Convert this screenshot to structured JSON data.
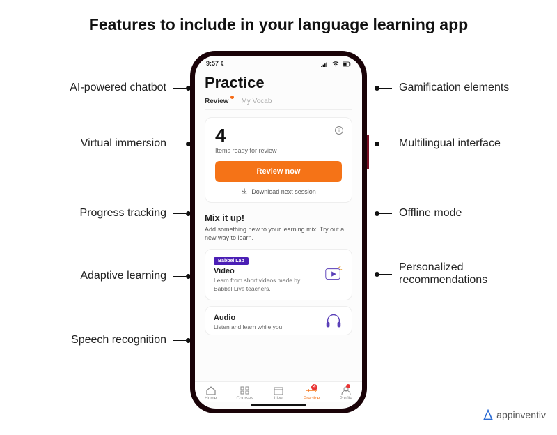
{
  "title": "Features to include in your language learning app",
  "left_features": [
    "AI-powered chatbot",
    "Virtual immersion",
    "Progress tracking",
    "Adaptive learning",
    "Speech recognition"
  ],
  "right_features": [
    "Gamification elements",
    "Multilingual interface",
    "Offline mode",
    "Personalized recommendations"
  ],
  "phone": {
    "status_time": "9:57",
    "page_title": "Practice",
    "tabs": {
      "review": "Review",
      "my_vocab": "My Vocab"
    },
    "review_card": {
      "count": "4",
      "label": "Items ready for review",
      "button": "Review now",
      "download": "Download next session"
    },
    "mix": {
      "title": "Mix it up!",
      "subtitle": "Add something new to your learning mix! Try out a new way to learn."
    },
    "video_card": {
      "badge": "Babbel Lab",
      "title": "Video",
      "desc": "Learn from short videos made by Babbel Live teachers."
    },
    "audio_card": {
      "title": "Audio",
      "desc": "Listen and learn while you"
    },
    "nav": {
      "home": "Home",
      "courses": "Courses",
      "live": "Live",
      "practice": "Practice",
      "profile": "Profile",
      "practice_badge": "4"
    }
  },
  "brand": "appinventiv"
}
